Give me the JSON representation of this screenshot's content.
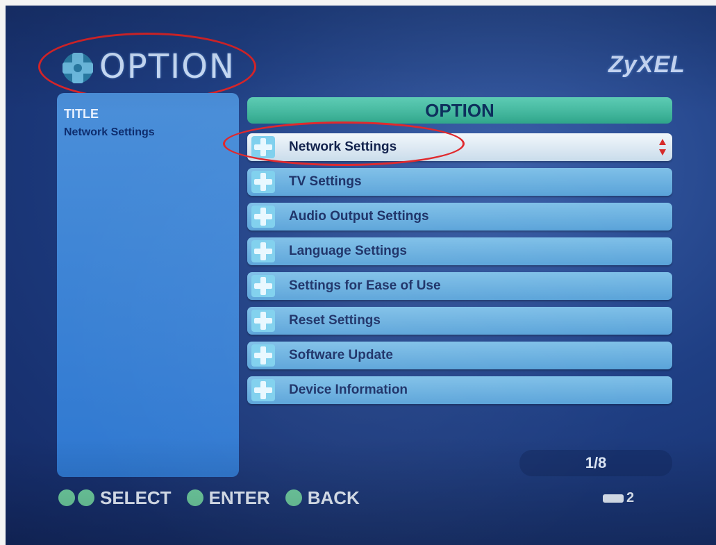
{
  "header": {
    "title": "OPTION",
    "brand": "ZyXEL"
  },
  "left_panel": {
    "title": "TITLE",
    "value": "Network Settings"
  },
  "menu": {
    "header": "OPTION",
    "items": [
      {
        "label": "Network Settings",
        "selected": true
      },
      {
        "label": "TV Settings"
      },
      {
        "label": "Audio Output Settings"
      },
      {
        "label": "Language Settings"
      },
      {
        "label": "Settings for Ease of Use"
      },
      {
        "label": "Reset Settings"
      },
      {
        "label": "Software Update"
      },
      {
        "label": "Device Information"
      }
    ]
  },
  "pagination": {
    "text": "1/8"
  },
  "footer": {
    "select": "SELECT",
    "enter": "ENTER",
    "back": "BACK",
    "counter": "2"
  },
  "colors": {
    "background": "#1f3f84",
    "menu_item": "#5aa3d9",
    "menu_selected": "#eef4fa",
    "option_header": "#2fa58a",
    "annotation": "#e0262a"
  },
  "icons": [
    "dpad-icon",
    "arrow-up-icon",
    "arrow-down-icon",
    "ok-button-icon",
    "back-button-icon",
    "remote-key-icon"
  ]
}
